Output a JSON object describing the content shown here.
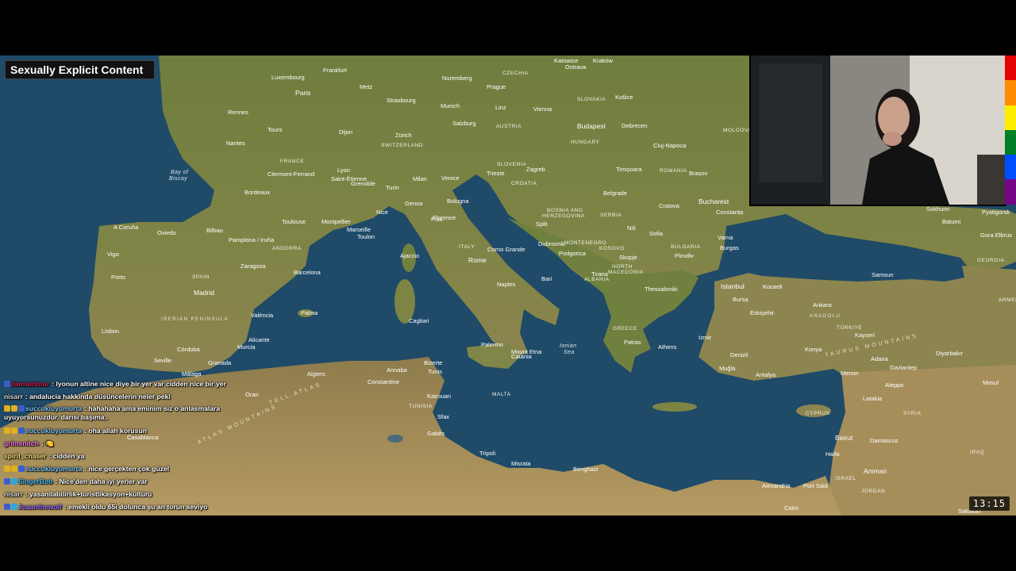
{
  "overlay": {
    "content_warning": "Sexually Explicit Content",
    "clock": "13:15"
  },
  "colors": {
    "pride": [
      "#e40303",
      "#ff8c00",
      "#ffed00",
      "#008026",
      "#004dff",
      "#750787"
    ],
    "sea": "#1f4a68",
    "land": "#6d7a3c"
  },
  "map": {
    "countries": [
      "CZECHIA",
      "SLOVAKIA",
      "AUSTRIA",
      "HUNGARY",
      "MOLDOVA",
      "SWITZERLAND",
      "SLOVENIA",
      "CROATIA",
      "ROMANIA",
      "FRANCE",
      "BOSNIA AND HERZEGOVINA",
      "SERBIA",
      "ITALY",
      "MONTENEGRO",
      "KOSOVO",
      "BULGARIA",
      "NORTH MACEDONIA",
      "ALBANIA",
      "GREECE",
      "SPAIN",
      "TÜRKIYE",
      "TUNISIA",
      "MALTA",
      "CYPRUS",
      "SYRIA",
      "IRAQ",
      "ISRAEL",
      "JORDAN",
      "GEORGIA",
      "ARMENIA",
      "ANDORRA"
    ],
    "seas": [
      "Bay of Biscay",
      "Ionian Sea"
    ],
    "regions": [
      "IBERIAN PENINSULA",
      "ANADOLU",
      "TAURUS MOUNTAINS",
      "TELL ATLAS",
      "ATLAS MOUNTAINS"
    ],
    "cities": [
      "Paris",
      "Luxembourg",
      "Frankfurt",
      "Nuremberg",
      "Prague",
      "Katowice",
      "Kraków",
      "Rennes",
      "Metz",
      "Strasbourg",
      "Munich",
      "Linz",
      "Vienna",
      "Košice",
      "Tours",
      "Dijon",
      "Salzburg",
      "Debrecen",
      "Nantes",
      "Zürich",
      "Budapest",
      "Cluj-Napoca",
      "Bordeaux",
      "Lyon",
      "Milan",
      "Venice",
      "Trieste",
      "Zagreb",
      "Timișoara",
      "Brașov",
      "Clermont-Ferrand",
      "Saint-Étienne",
      "Grenoble",
      "Turin",
      "Genoa",
      "Bologna",
      "Belgrade",
      "Bucharest",
      "Craiova",
      "Constanța",
      "A Coruña",
      "Oviedo",
      "Bilbao",
      "Pamplona / Iruña",
      "Toulouse",
      "Montpellier",
      "Marseille",
      "Toulon",
      "Nice",
      "Florence",
      "Pisa",
      "Split",
      "Niš",
      "Sofia",
      "Varna",
      "Burgas",
      "Vigo",
      "Zaragoza",
      "Barcelona",
      "Ajaccio",
      "Rome",
      "Dubrovnik",
      "Podgorica",
      "Skopje",
      "Plovdiv",
      "Porto",
      "Madrid",
      "Tirana",
      "Bari",
      "Naples",
      "Thessaloniki",
      "Istanbul",
      "Kocaeli",
      "Samsun",
      "Bursa",
      "Ankara",
      "Valencia",
      "Palma",
      "Cagliari",
      "Lisbon",
      "Alicante",
      "Murcia",
      "Patras",
      "Athens",
      "Izmir",
      "Eskişehir",
      "Konya",
      "Kayseri",
      "Diyarbakır",
      "Seville",
      "Córdoba",
      "Granada",
      "Málaga",
      "Palermo",
      "Catania",
      "Denizli",
      "Antalya",
      "Adana",
      "Mersin",
      "Gaziantep",
      "Algiers",
      "Annaba",
      "Constantine",
      "Oran",
      "Tunis",
      "Sfax",
      "Gabès",
      "Kairouan",
      "Aleppo",
      "Latakia",
      "Tripoli",
      "Misrata",
      "Benghazi",
      "Beirut",
      "Damascus",
      "Haifa",
      "Amman",
      "Alexandria",
      "Port Said",
      "Cairo",
      "Mosul",
      "Sokhumi",
      "Batumi",
      "Sakakah",
      "Muğla",
      "Casablanca",
      "Bizerte",
      "Mount Etna",
      "Corno Grande",
      "Gora Elbrus",
      "Pyatigorsk"
    ]
  },
  "chat": [
    {
      "user": "liamwintour",
      "user_color": "#d61f55",
      "badges": [
        "#3a5fcd"
      ],
      "text": "lyonun altine nice diye bir yer var cidden nice bir yer"
    },
    {
      "user": "nisarr",
      "user_color": "#dddddd",
      "badges": [],
      "text": "andalucia hakkinda düsüncelerin neler peki"
    },
    {
      "user": "succukluyumurta",
      "user_color": "#7ec8ff",
      "badges": [
        "#e0b020",
        "#e0b020",
        "#3a5fcd"
      ],
      "text": "hahahaha ama eminim siz o anlasmalara uyuyorsunuzdur. darısı başıma..",
      "wrap": true
    },
    {
      "user": "succukluyumurta",
      "user_color": "#7ec8ff",
      "badges": [
        "#e0b020",
        "#e0b020",
        "#3a5fcd"
      ],
      "text": "oha allah korusun"
    },
    {
      "user": "grimsnitch",
      "user_color": "#ff7de9",
      "badges": [],
      "text": "🍋"
    },
    {
      "user": "spirit_chaser",
      "user_color": "#f6e27a",
      "badges": [],
      "text": "cidden ya"
    },
    {
      "user": "succukluyumurta",
      "user_color": "#7ec8ff",
      "badges": [
        "#e0b020",
        "#e0b020",
        "#3a5fcd"
      ],
      "text": "nice gerçekten çok güzel"
    },
    {
      "user": "SingerBob",
      "user_color": "#4fc3f7",
      "badges": [
        "#3a5fcd",
        "#29a8e0"
      ],
      "text": "Nice'den daha iyi yerler var"
    },
    {
      "user": "nisarr",
      "user_color": "#dddddd",
      "badges": [],
      "text": "yasanilabilirlik+turistlikasyon+kültürü"
    },
    {
      "user": "Joaanthewolf",
      "user_color": "#a070ff",
      "badges": [
        "#3a5fcd",
        "#29a8e0"
      ],
      "text": "emekli oldu 65i dolunca şu an torun seviyo"
    }
  ]
}
